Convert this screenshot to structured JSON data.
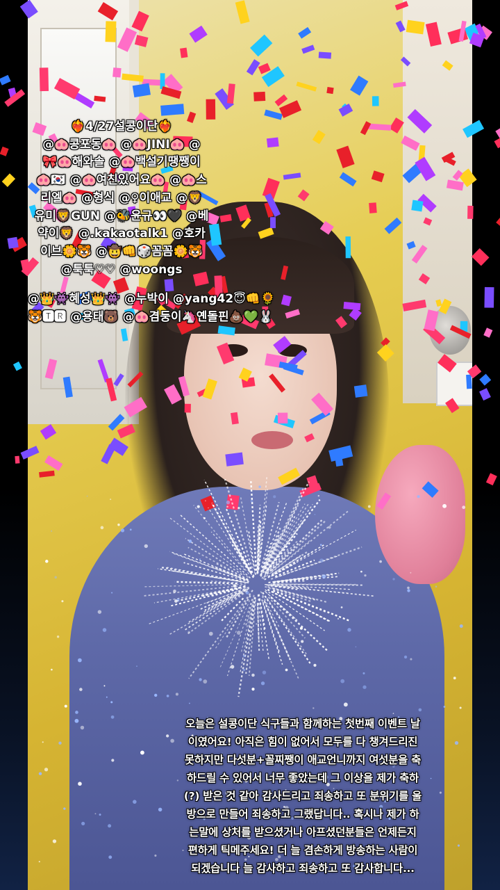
{
  "overlay": {
    "user_list_lines": [
      "❤️‍🔥4/27설콩이단❤️‍🔥",
      "@🐽콩포동🐽 @🐽JINI🐽 @",
      "🎀🐽해와솔 @🐽백설기땡쨍이",
      "🐽🇰🇷 @🐽여친있어요🐽 @🐽스",
      "리엘🐽 @형식 @♀이애교 @🦁",
      "유미🦁GUN @🐝윤규👀🖤 @베",
      "약이🦁 @.kakaotalk1 @호카",
      "이브🌼🐯 @🤠👊🎲꼼꼼🌼🐯",
      "@툭툭♡♡ @woongs",
      "",
      "@👑👾혜성👑👾 @누박이 @yang42😇👊🌻",
      "🐯🆃🆁 @용태🐻 @🐽겸둥이🦄옌돌핀💩💚🐰"
    ],
    "caption_lines": [
      "오늘은 설콩이단 식구들과 함께하는 첫번째 이벤트 날",
      "이였어요! 아직은 힘이 없어서 모두를 다 챙겨드리진",
      "못하지만 다섯분+꼴찌쨍이 애교언니까지 여섯분을 축",
      "하드릴 수 있어서 너무 좋았는데 그 이상을 제가 축하",
      "(?) 받은 것 같아 감사드리고 죄송하고 또 분위기를 울",
      "방으로 만들어 죄송하고 그랬답니다.. 혹시나 제가 하",
      "는말에 상처를 받으셨거나 아프셨던분들은 언제든지",
      "편하게 틱메주세요! 더 늘 겸손하게 방송하는 사람이",
      "되겠습니다 늘 감사하고 죄송하고 또 감사합니다..."
    ]
  },
  "effects": {
    "confetti_colors": [
      "#ff3a6e",
      "#ff2f5a",
      "#ffd21e",
      "#2f7bff",
      "#7a4dff",
      "#ff6ec7",
      "#1fc6ff",
      "#e8202a",
      "#b03cff"
    ],
    "firework_color": "#ffffff",
    "sparkle_color": "#9ab8ff"
  }
}
